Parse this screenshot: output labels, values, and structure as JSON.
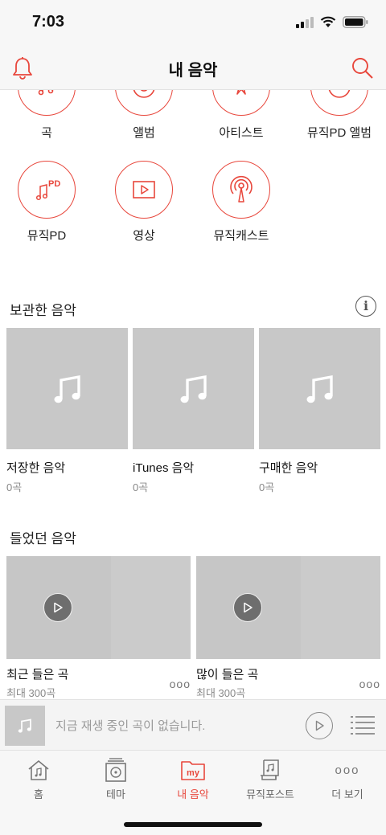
{
  "status": {
    "time": "7:03"
  },
  "header": {
    "title": "내 음악"
  },
  "categories": [
    {
      "label": "곡",
      "icon": "song-icon"
    },
    {
      "label": "앨범",
      "icon": "album-icon"
    },
    {
      "label": "아티스트",
      "icon": "artist-icon"
    },
    {
      "label": "뮤직PD 앨범",
      "icon": "musicpd-album-icon"
    },
    {
      "label": "뮤직PD",
      "icon": "musicpd-icon"
    },
    {
      "label": "영상",
      "icon": "video-icon"
    },
    {
      "label": "뮤직캐스트",
      "icon": "musiccast-icon"
    }
  ],
  "saved": {
    "title": "보관한 음악",
    "info": "i",
    "items": [
      {
        "name": "저장한 음악",
        "count": "0곡"
      },
      {
        "name": "iTunes 음악",
        "count": "0곡"
      },
      {
        "name": "구매한 음악",
        "count": "0곡"
      }
    ]
  },
  "played": {
    "title": "들었던 음악",
    "items": [
      {
        "name": "최근 들은 곡",
        "sub": "최대 300곡"
      },
      {
        "name": "많이 들은 곡",
        "sub": "최대 300곡"
      }
    ],
    "more": "ooo"
  },
  "player": {
    "message": "지금 재생 중인 곡이 없습니다."
  },
  "tabs": [
    {
      "label": "홈",
      "icon": "home-icon"
    },
    {
      "label": "테마",
      "icon": "theme-icon"
    },
    {
      "label": "내 음악",
      "icon": "my-music-icon",
      "badge": "my",
      "active": true
    },
    {
      "label": "뮤직포스트",
      "icon": "music-post-icon"
    },
    {
      "label": "더 보기",
      "icon": "more-icon",
      "glyph": "ooo"
    }
  ],
  "colors": {
    "accent": "#e8473c",
    "placeholder": "#c8c8c8",
    "bar": "#f7f7f7"
  }
}
